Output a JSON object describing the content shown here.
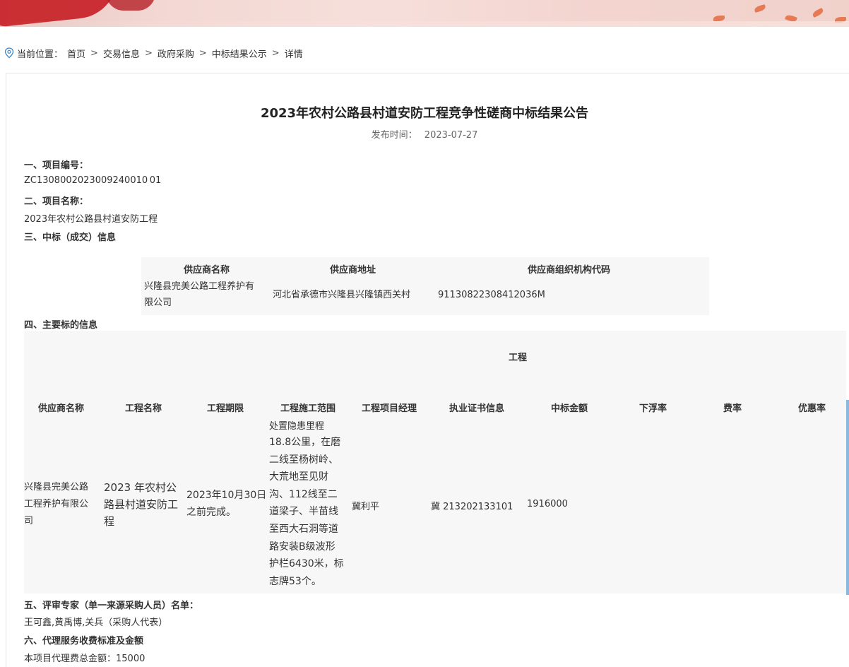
{
  "breadcrumb": {
    "prefix": "当前位置：",
    "items": [
      "首页",
      "交易信息",
      "政府采购",
      "中标结果公示",
      "详情"
    ],
    "separator": ">"
  },
  "article": {
    "title": "2023年农村公路县村道安防工程竞争性磋商中标结果公告",
    "publish_label": "发布时间：",
    "publish_date": "2023-07-27"
  },
  "sections": {
    "s1_heading": "一、项目编号：",
    "s1_value": "ZC1308002023009240010 01",
    "s2_heading": "二、项目名称：",
    "s2_value": "2023年农村公路县村道安防工程",
    "s3_heading": "三、中标（成交）信息",
    "s4_heading": "四、主要标的信息",
    "s5_heading": "五、评审专家（单一来源采购人员）名单：",
    "s5_value": "王可鑫,黄禹博,关兵（采购人代表）",
    "s6_heading": "六、代理服务收费标准及金额",
    "s6_value": "本项目代理费总金额：15000"
  },
  "winner_table": {
    "headers": [
      "供应商名称",
      "供应商地址",
      "供应商组织机构代码"
    ],
    "row": {
      "name_line1": "兴隆县完美公路工程养护有",
      "name_line2": "限公司",
      "address": "河北省承德市兴隆县兴隆镇西关村",
      "code": "91130822308412036M"
    }
  },
  "subject_table": {
    "group_label": "工程",
    "headers": [
      "供应商名称",
      "工程名称",
      "工程期限",
      "工程施工范围",
      "工程项目经理",
      "执业证书信息",
      "中标金额",
      "下浮率",
      "费率",
      "优惠率"
    ],
    "row": {
      "supplier_l1": "兴隆县完美公路",
      "supplier_l2": "工程养护有限公",
      "supplier_l3": "司",
      "project_l1": "2023 年农村公",
      "project_l2": "路县村道安防工",
      "project_l3": "程",
      "term_l1": "2023年10月30日",
      "term_l2": "之前完成。",
      "scope_first": "处置隐患里程",
      "scope_rest": [
        "18.8公里，在磨",
        "二线至杨树岭、",
        "大荒地至见财",
        "沟、112线至二",
        "道梁子、半苗线",
        "至西大石洞等道",
        "路安装B级波形",
        "护栏6430米，标",
        "志牌53个。"
      ],
      "manager": "冀利平",
      "cert": "冀 213202133101",
      "amount": "1916000"
    }
  }
}
